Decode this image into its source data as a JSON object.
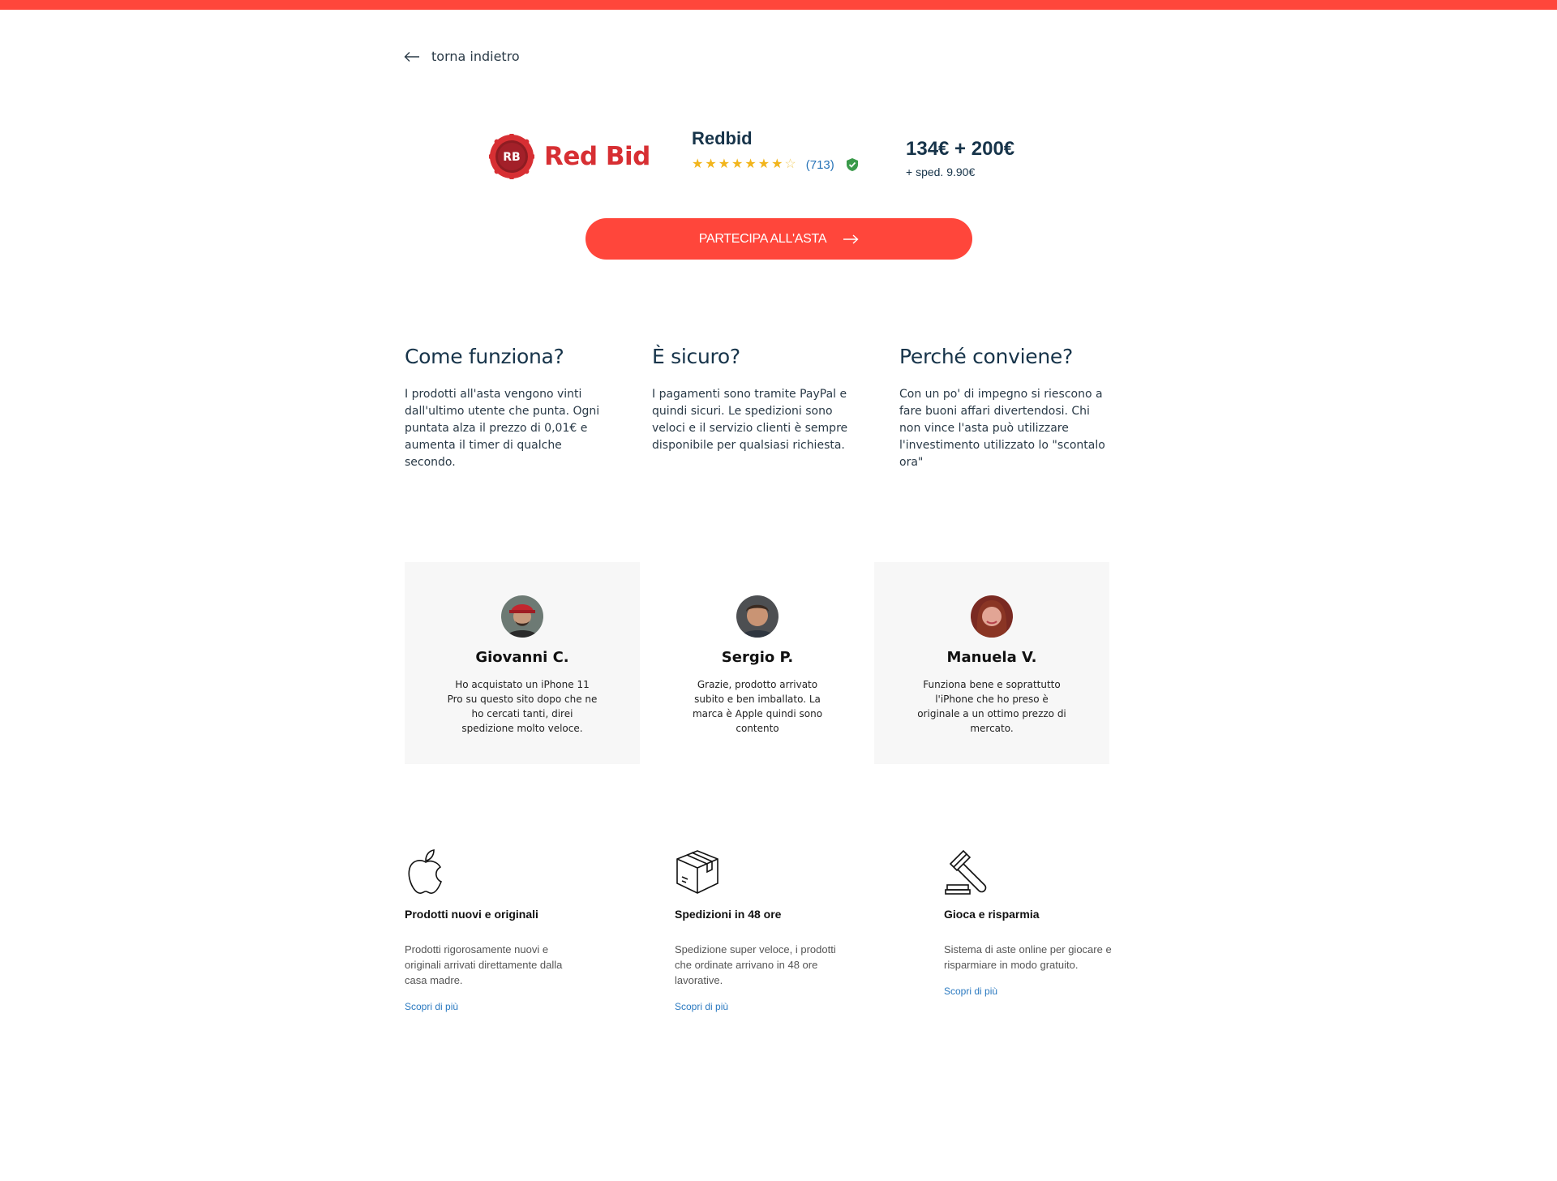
{
  "colors": {
    "accent": "#ff463b",
    "brand": "#d72f33",
    "text": "#17344a",
    "link": "#2a79c0",
    "star": "#f2b51c",
    "verified": "#3a9a4a"
  },
  "nav": {
    "back_label": "torna indietro"
  },
  "logo": {
    "badge_text": "RB",
    "text": "Red Bid"
  },
  "seller": {
    "name": "Redbid",
    "rating_stars": 7.5,
    "rating_max": 8,
    "reviews_count": "(713)",
    "verified": true
  },
  "price": {
    "main": "134€ + 200€",
    "shipping": "+ sped. 9.90€"
  },
  "cta": {
    "label": "PARTECIPA ALL'ASTA"
  },
  "info": [
    {
      "title": "Come funziona?",
      "text": "I prodotti all'asta vengono vinti dall'ultimo utente che punta. Ogni puntata alza il prezzo di 0,01€ e aumenta il timer di qualche secondo."
    },
    {
      "title": "È sicuro?",
      "text": "I pagamenti sono tramite PayPal e quindi sicuri. Le spedizioni sono veloci e il servizio clienti è sempre disponibile per qualsiasi richiesta."
    },
    {
      "title": "Perché conviene?",
      "text": "Con un po' di impegno si riescono a fare buoni affari divertendosi. Chi non vince l'asta può utilizzare l'investimento utilizzato lo \"scontalo ora\""
    }
  ],
  "testimonials": [
    {
      "name": "Giovanni C.",
      "text": "Ho acquistato un iPhone 11 Pro su questo sito dopo che ne ho cercati tanti, direi spedizione molto veloce."
    },
    {
      "name": "Sergio P.",
      "text": "Grazie, prodotto arrivato subito e ben imballato. La marca è Apple quindi sono contento"
    },
    {
      "name": "Manuela V.",
      "text": "Funziona bene e soprattutto l'iPhone che ho preso è originale a un ottimo prezzo di mercato."
    }
  ],
  "features": [
    {
      "icon": "apple-icon",
      "title": "Prodotti nuovi e originali",
      "text": "Prodotti rigorosamente nuovi e originali arrivati direttamente dalla casa madre.",
      "link": "Scopri di più"
    },
    {
      "icon": "box-icon",
      "title": "Spedizioni in 48 ore",
      "text": "Spedizione super veloce, i prodotti che ordinate arrivano in 48 ore lavorative.",
      "link": "Scopri di più"
    },
    {
      "icon": "gavel-icon",
      "title": "Gioca e risparmia",
      "text": "Sistema di aste online per giocare e risparmiare in modo gratuito.",
      "link": "Scopri di più"
    }
  ]
}
